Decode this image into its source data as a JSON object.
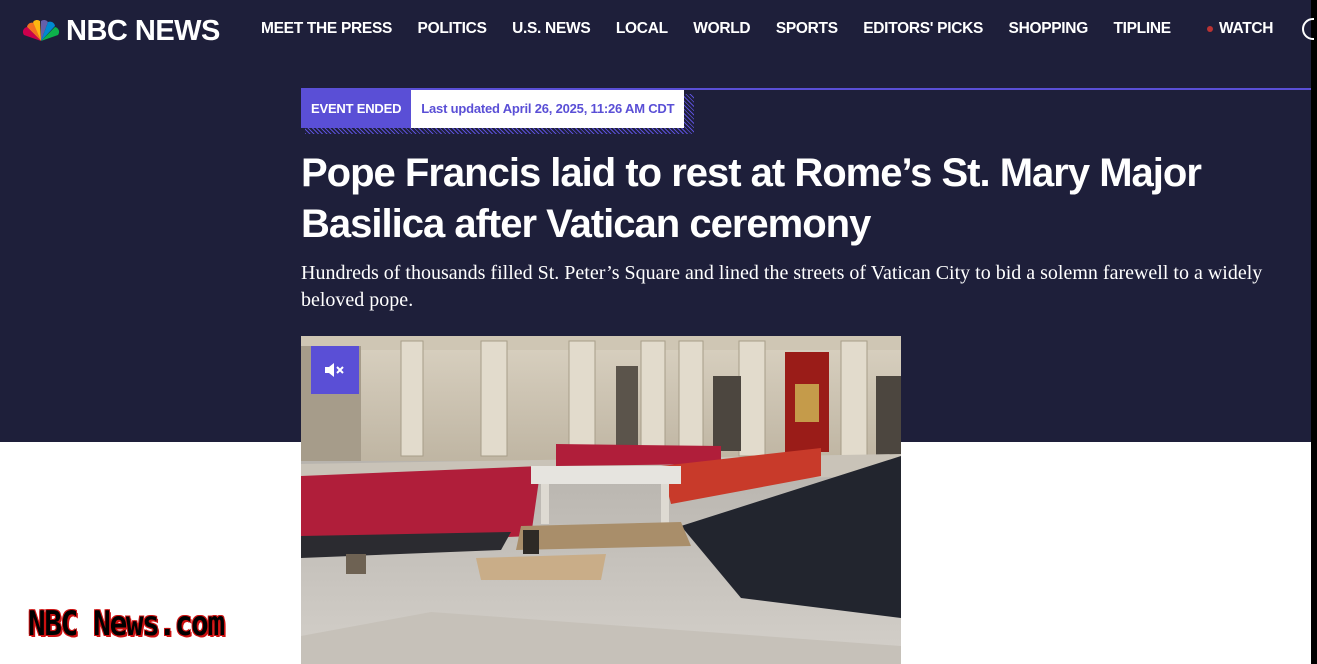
{
  "header": {
    "logo_text": "NBC NEWS",
    "nav_items": [
      "MEET THE PRESS",
      "POLITICS",
      "U.S. NEWS",
      "LOCAL",
      "WORLD",
      "SPORTS",
      "EDITORS' PICKS",
      "SHOPPING",
      "TIPLINE"
    ],
    "watch_label": "WATCH"
  },
  "event": {
    "status_badge": "EVENT ENDED",
    "last_updated": "Last updated April 26, 2025, 11:26 AM CDT"
  },
  "article": {
    "headline": "Pope Francis laid to rest at Rome’s St. Mary Major Basilica after Vatican ceremony",
    "dek": "Hundreds of thousands filled St. Peter’s Square and lined the streets of Vatican City to bid a solemn farewell to a widely beloved pope."
  },
  "watermark": "NBC News.com",
  "colors": {
    "hero_bg": "#1e1f3a",
    "accent": "#5a4fd6"
  },
  "icons": {
    "logo": "nbc-peacock-icon",
    "mute": "volume-mute-icon",
    "search": "search-icon"
  }
}
